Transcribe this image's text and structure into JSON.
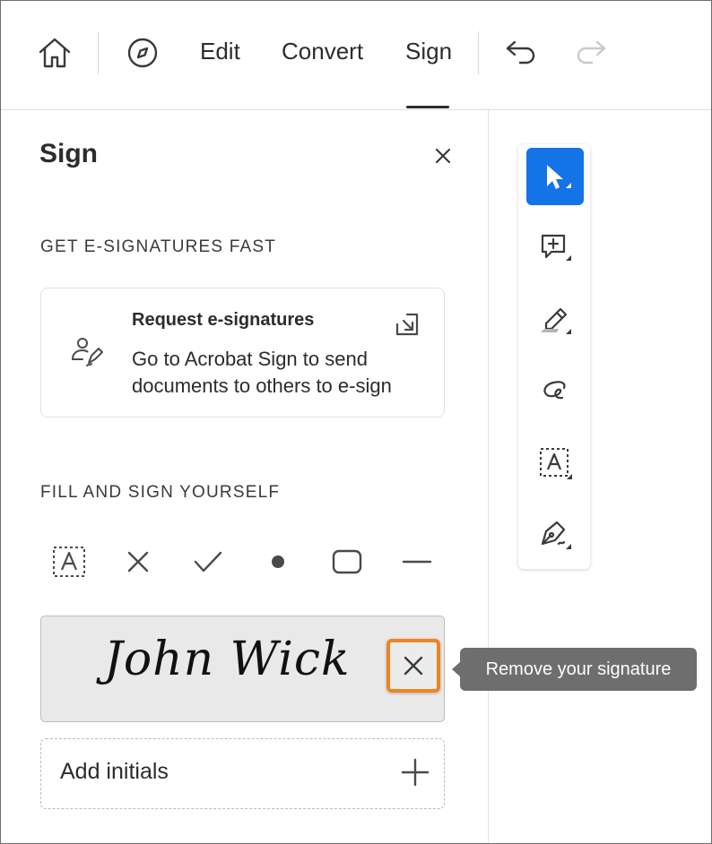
{
  "toolbar": {
    "home_icon": "home-icon",
    "explore_icon": "compass-icon",
    "tabs": [
      {
        "label": "Edit"
      },
      {
        "label": "Convert"
      },
      {
        "label": "Sign",
        "active": true
      }
    ],
    "undo_icon": "undo-icon",
    "redo_icon": "redo-icon"
  },
  "panel": {
    "title": "Sign",
    "close_icon": "close-icon",
    "section_esign": {
      "heading": "GET E-SIGNATURES FAST",
      "card": {
        "title": "Request e-signatures",
        "description": "Go to Acrobat Sign to send documents to others to e-sign",
        "icon": "user-sign-icon",
        "open_icon": "open-external-icon"
      }
    },
    "section_fill": {
      "heading": "FILL AND SIGN YOURSELF",
      "tools": [
        {
          "name": "text-field-icon"
        },
        {
          "name": "cross-mark-icon"
        },
        {
          "name": "checkmark-icon"
        },
        {
          "name": "dot-icon"
        },
        {
          "name": "rounded-rect-icon"
        },
        {
          "name": "line-icon"
        }
      ]
    },
    "signature": {
      "text": "John Wick",
      "remove_icon": "close-icon"
    },
    "initials": {
      "label": "Add initials",
      "add_icon": "plus-icon"
    }
  },
  "rail": {
    "tools": [
      {
        "name": "select-cursor-icon",
        "active": true
      },
      {
        "name": "add-comment-icon"
      },
      {
        "name": "highlight-icon"
      },
      {
        "name": "freehand-draw-icon"
      },
      {
        "name": "text-box-icon"
      },
      {
        "name": "sign-pen-icon"
      }
    ]
  },
  "tooltip": {
    "text": "Remove your signature"
  },
  "colors": {
    "accent_blue": "#1473e6",
    "highlight_orange": "#f0841f",
    "tooltip_gray": "#6e6e6e"
  }
}
